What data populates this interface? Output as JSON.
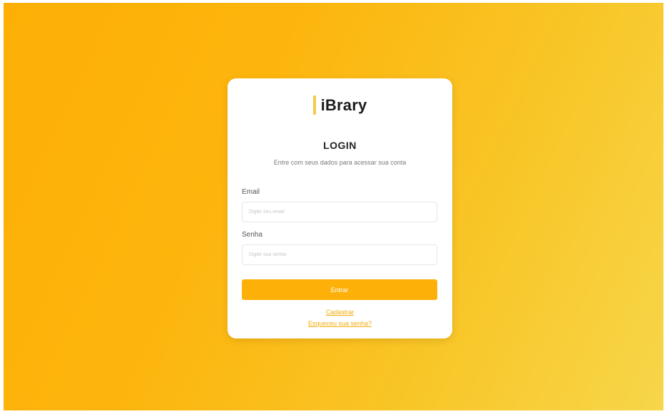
{
  "brand": {
    "name": "iBrary",
    "accent_color": "#f7c948"
  },
  "login": {
    "title": "LOGIN",
    "subtitle": "Entre com seus dados para acessar sua conta",
    "email_label": "Email",
    "email_value": "",
    "email_placeholder": "Digite seu email",
    "password_label": "Senha",
    "password_value": "",
    "password_placeholder": "Digite sua senha",
    "submit_label": "Entrar",
    "register_link": "Cadastrar",
    "forgot_link": "Esqueceu sua senha?"
  },
  "colors": {
    "primary": "#fdb008",
    "background_start": "#fdaf06",
    "background_end": "#f7d64a",
    "card": "#ffffff"
  }
}
